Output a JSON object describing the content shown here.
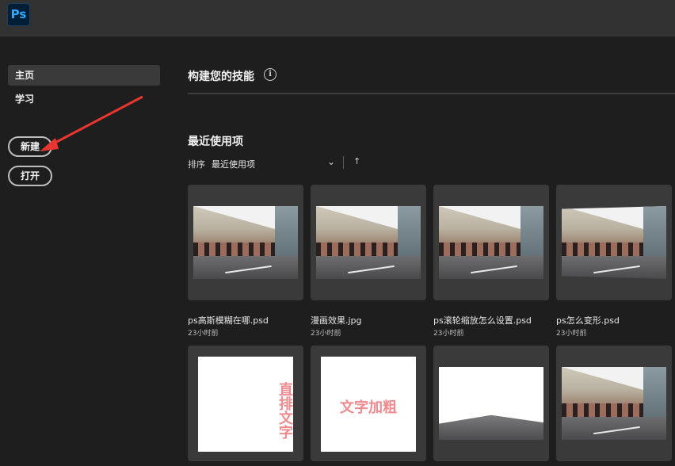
{
  "app": {
    "logo_text": "Ps"
  },
  "sidebar": {
    "items": [
      {
        "label": "主页",
        "active": true
      },
      {
        "label": "学习",
        "active": false
      }
    ],
    "new_button": "新建",
    "open_button": "打开"
  },
  "main": {
    "title": "构建您的技能",
    "info_icon": "i",
    "recent_title": "最近使用项",
    "sort_label": "排序",
    "sort_value": "最近使用项",
    "sort_chevron": "⌄",
    "sort_direction_icon": "↑"
  },
  "files": [
    {
      "name": "ps高斯模糊在哪.psd",
      "time": "23小时前",
      "thumb": "street-photo"
    },
    {
      "name": "漫画效果.jpg",
      "time": "23小时前",
      "thumb": "street-photo"
    },
    {
      "name": "ps滚轮缩放怎么设置.psd",
      "time": "23小时前",
      "thumb": "street-photo"
    },
    {
      "name": "ps怎么变形.psd",
      "time": "23小时前",
      "thumb": "street-photo-warped"
    },
    {
      "name": "",
      "time": "",
      "thumb": "vertical-text",
      "text": "直排文字"
    },
    {
      "name": "",
      "time": "",
      "thumb": "horizontal-text",
      "text": "文字加粗"
    },
    {
      "name": "",
      "time": "",
      "thumb": "panorama"
    },
    {
      "name": "",
      "time": "",
      "thumb": "street-photo"
    }
  ],
  "colors": {
    "background": "#1e1e1e",
    "topbar": "#323232",
    "accent_ps": "#31a8ff",
    "arrow": "#e8362f",
    "thumb_text": "#ef8a8f"
  }
}
